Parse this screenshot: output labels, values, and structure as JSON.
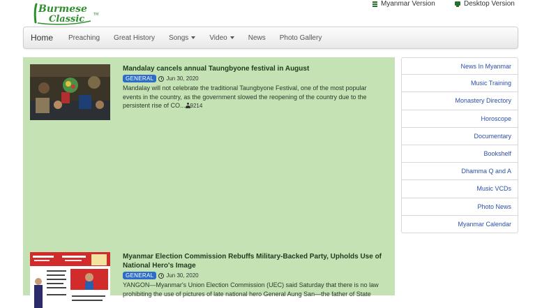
{
  "brand": {
    "logo_line1": "Burmese",
    "logo_line2": "Classic",
    "logo_mark": "TM"
  },
  "toplinks": {
    "myanmar": "Myanmar Version",
    "desktop": "Desktop Version"
  },
  "nav": {
    "home": "Home",
    "preaching": "Preaching",
    "great_history": "Great History",
    "songs": "Songs",
    "video": "Video",
    "news": "News",
    "photo_gallery": "Photo Gallery"
  },
  "articles": [
    {
      "title": "Mandalay cancels annual Taungbyone festival in August",
      "category": "GENERAL",
      "date": "Jun 30, 2020",
      "excerpt": "Mandalay will not celebrate the traditional Taungbyone Festival, one of the most popular events in the country, as the government slowed the reopening of the country due to the persistent rise of CO...",
      "views": "9214"
    },
    {
      "title": "Myanmar Election Commission Rebuffs Military-Backed Party, Upholds Use of National Hero's Image",
      "category": "GENERAL",
      "date": "Jun 30, 2020",
      "excerpt": "YANGON—Myanmar's Union Election Commission (UEC) said Saturday that there is no law prohibiting the use of pictures of late national hero General Aung San—the father of State"
    }
  ],
  "sidebar": [
    "News In Myanmar",
    "Music Training",
    "Monastery Directory",
    "Horoscope",
    "Documentary",
    "Bookshelf",
    "Dhamma Q and A",
    "Music VCDs",
    "Photo News",
    "Myanmar Calendar"
  ],
  "colors": {
    "content_bg": "#c4e2b4",
    "badge": "#2e6cc9",
    "link": "#2a4fa8",
    "logo_green": "#2f8f2f"
  }
}
